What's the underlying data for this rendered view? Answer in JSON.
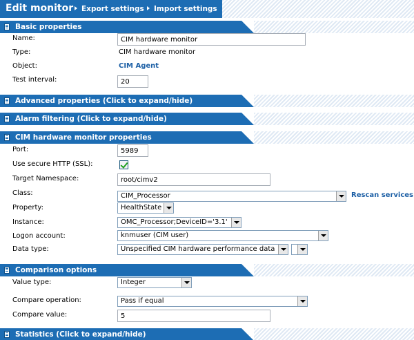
{
  "header": {
    "title": "Edit monitor",
    "export_label": "Export settings",
    "import_label": "Import settings"
  },
  "sections": {
    "basic": "Basic properties",
    "advanced": "Advanced properties (Click to expand/hide)",
    "alarm": "Alarm filtering (Click to expand/hide)",
    "cim": "CIM hardware monitor properties",
    "comparison": "Comparison options",
    "statistics": "Statistics (Click to expand/hide)"
  },
  "basic": {
    "name_label": "Name:",
    "name_value": "CIM hardware monitor",
    "type_label": "Type:",
    "type_value": "CIM hardware monitor",
    "object_label": "Object:",
    "object_value": "CIM Agent",
    "interval_label": "Test interval:",
    "interval_value": "20"
  },
  "cim": {
    "port_label": "Port:",
    "port_value": "5989",
    "ssl_label": "Use secure HTTP (SSL):",
    "ssl_checked": true,
    "namespace_label": "Target Namespace:",
    "namespace_value": "root/cimv2",
    "class_label": "Class:",
    "class_value": "CIM_Processor",
    "rescan_label": "Rescan services",
    "property_label": "Property:",
    "property_value": "HealthState",
    "instance_label": "Instance:",
    "instance_value": "OMC_Processor;DeviceID='3.1'",
    "logon_label": "Logon account:",
    "logon_value": "knmuser (CIM user)",
    "datatype_label": "Data type:",
    "datatype_value": "Unspecified CIM hardware performance data",
    "datatype_extra_value": ""
  },
  "comparison": {
    "valuetype_label": "Value type:",
    "valuetype_value": "Integer",
    "operation_label": "Compare operation:",
    "operation_value": "Pass if equal",
    "compare_value_label": "Compare value:",
    "compare_value": "5"
  },
  "colors": {
    "header_blue": "#1d6db4",
    "link_blue": "#1c5fa5",
    "check_green": "#21a121"
  }
}
